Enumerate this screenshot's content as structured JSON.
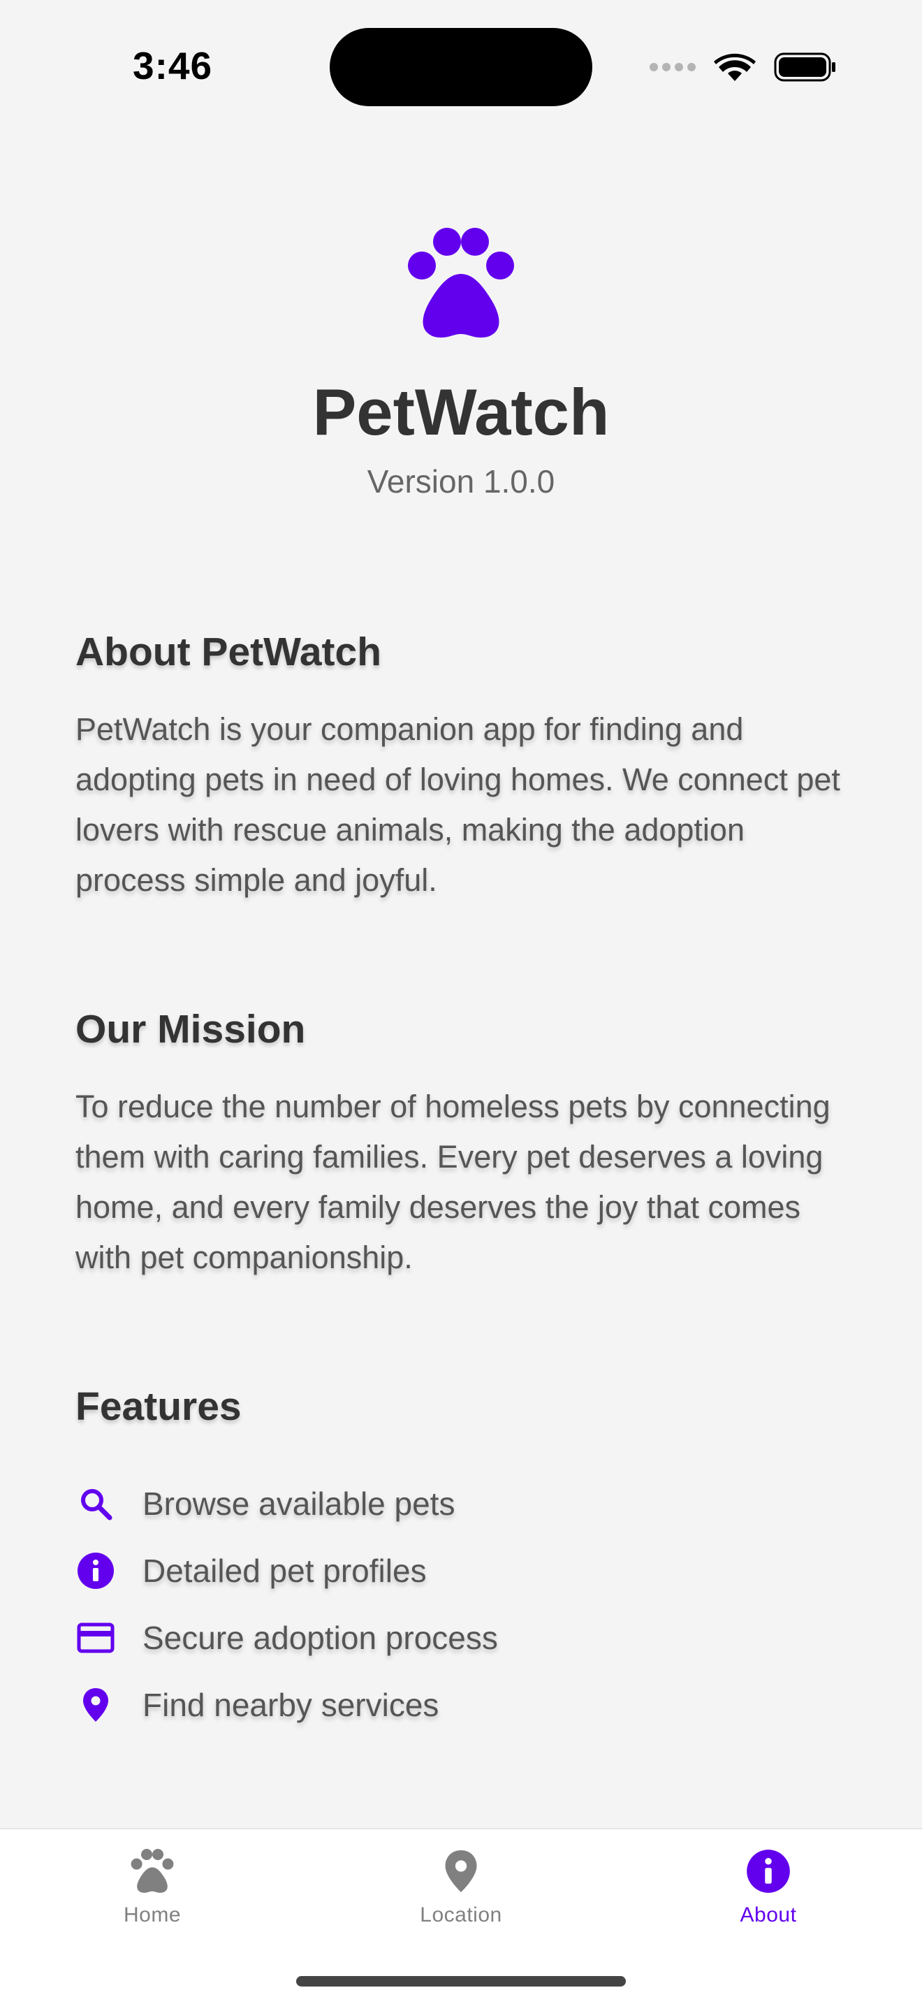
{
  "status_bar": {
    "time": "3:46"
  },
  "header": {
    "app_name": "PetWatch",
    "version": "Version 1.0.0",
    "logo_icon": "paw-icon"
  },
  "sections": {
    "about": {
      "title": "About PetWatch",
      "body": "PetWatch is your companion app for finding and adopting pets in need of loving homes. We connect pet lovers with rescue animals, making the adoption process simple and joyful."
    },
    "mission": {
      "title": "Our Mission",
      "body": "To reduce the number of homeless pets by connecting them with caring families. Every pet deserves a loving home, and every family deserves the joy that comes with pet companionship."
    },
    "features": {
      "title": "Features",
      "items": [
        {
          "icon": "search-icon",
          "label": "Browse available pets"
        },
        {
          "icon": "info-icon",
          "label": "Detailed pet profiles"
        },
        {
          "icon": "credit-card-icon",
          "label": "Secure adoption process"
        },
        {
          "icon": "location-pin-icon",
          "label": "Find nearby services"
        }
      ]
    }
  },
  "tab_bar": {
    "tabs": [
      {
        "label": "Home",
        "icon": "paw-icon",
        "active": false
      },
      {
        "label": "Location",
        "icon": "location-pin-icon",
        "active": false
      },
      {
        "label": "About",
        "icon": "info-icon",
        "active": true
      }
    ]
  },
  "colors": {
    "accent": "#6200ee",
    "background": "#f4f4f4",
    "heading": "#333333",
    "body_text": "#555555",
    "inactive_tab": "#808080"
  }
}
